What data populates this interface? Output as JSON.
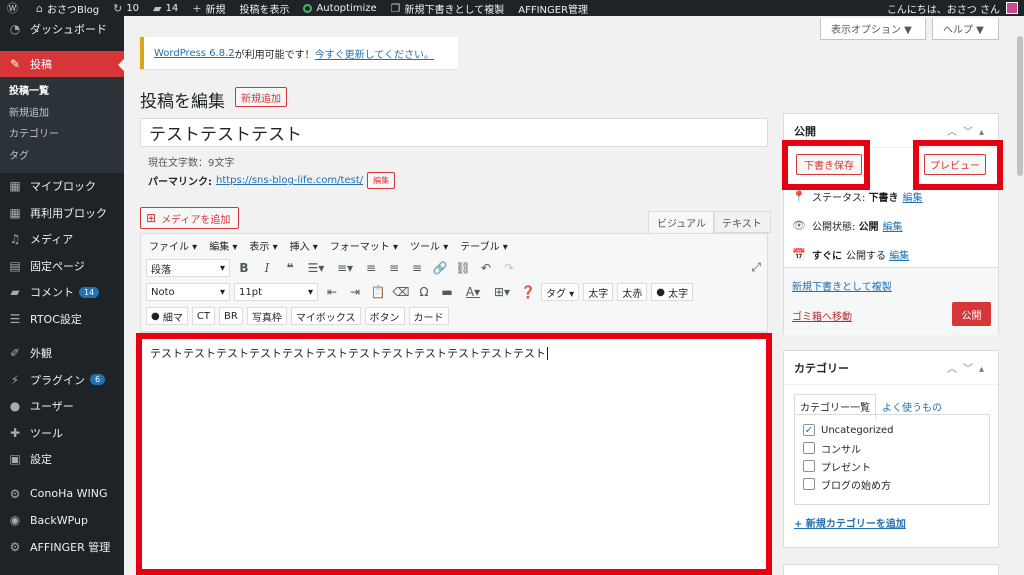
{
  "admin_bar": {
    "site_name": "おさつBlog",
    "updates_count": "10",
    "comments_count": "14",
    "new_label": "新規",
    "view_post": "投稿を表示",
    "autoptimize": "Autoptimize",
    "duplicate": "新規下書きとして複製",
    "affinger": "AFFINGER管理",
    "greeting": "こんにちは、おさつ さん"
  },
  "sidebar": {
    "dashboard": "ダッシュボード",
    "posts": "投稿",
    "sub": [
      "投稿一覧",
      "新規追加",
      "カテゴリー",
      "タグ"
    ],
    "my_block": "マイブロック",
    "reusable": "再利用ブロック",
    "media": "メディア",
    "pages": "固定ページ",
    "comments": "コメント",
    "comments_badge": "14",
    "rtoc": "RTOC設定",
    "appearance": "外観",
    "plugins": "プラグイン",
    "plugins_badge": "6",
    "users": "ユーザー",
    "tools": "ツール",
    "settings": "設定",
    "conoha": "ConoHa WING",
    "backwpup": "BackWPup",
    "affinger": "AFFINGER 管理"
  },
  "screen_options": "表示オプション ▼",
  "help": "ヘルプ ▼",
  "notice": {
    "text1": "WordPress 6.8.2",
    "text2": " が利用可能です！",
    "link": "今すぐ更新してください。"
  },
  "page_title": "投稿を編集",
  "add_new": "新規追加",
  "post_title": "テストテストテスト",
  "char_count": "現在文字数：9文字",
  "permalink": {
    "label": "パーマリンク:",
    "url": "https://sns-blog-life.com/test/",
    "edit": "編集"
  },
  "add_media": "メディアを追加",
  "tabs": {
    "visual": "ビジュアル",
    "text": "テキスト"
  },
  "menubar": [
    "ファイル ▾",
    "編集 ▾",
    "表示 ▾",
    "挿入 ▾",
    "フォーマット ▾",
    "ツール ▾",
    "テーブル ▾"
  ],
  "toolbar": {
    "format_select": "段落",
    "font_select": "Noto",
    "size_select": "11pt",
    "tag_select": "タグ ▾",
    "futoji": "太字",
    "futoaka": "太赤",
    "futoji2": "太字",
    "hosomaru": "細マ",
    "ct": "CT",
    "br": "BR",
    "shashinwaku": "写真枠",
    "mybox": "マイボックス",
    "button": "ボタン",
    "card": "カード"
  },
  "editor_content": "テストテストテストテストテストテストテストテストテストテストテストテスト",
  "publish_box": {
    "title": "公開",
    "save_draft": "下書き保存",
    "preview": "プレビュー",
    "status_label": "ステータス:",
    "status_value": "下書き",
    "visibility_label": "公開状態:",
    "visibility_value": "公開",
    "schedule_label": "すぐに",
    "schedule_suffix": "公開する",
    "edit": "編集",
    "duplicate_link": "新規下書きとして複製",
    "trash": "ゴミ箱へ移動",
    "publish": "公開"
  },
  "category_box": {
    "title": "カテゴリー",
    "tab_all": "カテゴリー一覧",
    "tab_popular": "よく使うもの",
    "items": [
      {
        "label": "Uncategorized",
        "checked": true
      },
      {
        "label": "コンサル",
        "checked": false
      },
      {
        "label": "プレゼント",
        "checked": false
      },
      {
        "label": "ブログの始め方",
        "checked": false
      }
    ],
    "add_new": "+ 新規カテゴリーを追加"
  },
  "colors": {
    "accent_red": "#d63638",
    "highlight_red": "#e60012",
    "admin_dark": "#1d2327",
    "link_blue": "#2271b1"
  }
}
